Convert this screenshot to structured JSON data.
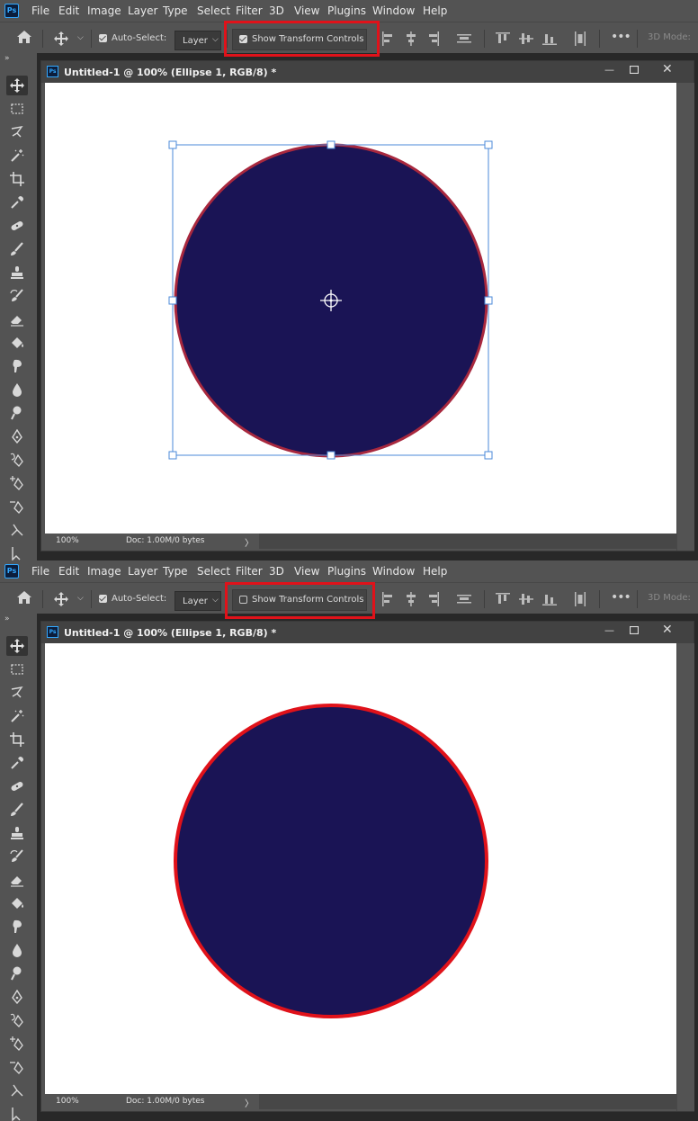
{
  "menus": [
    "File",
    "Edit",
    "Image",
    "Layer",
    "Type",
    "Select",
    "Filter",
    "3D",
    "View",
    "Plugins",
    "Window",
    "Help"
  ],
  "options": {
    "auto_select_label": "Auto-Select:",
    "layer_dropdown": "Layer",
    "show_transform_controls_label": "Show Transform Controls",
    "mode_3d_label": "3D Mode:"
  },
  "document": {
    "title": "Untitled-1 @ 100% (Ellipse 1, RGB/8) *",
    "zoom": "100%",
    "doc_info": "Doc: 1.00M/0 bytes"
  },
  "tools": [
    "move-tool",
    "marquee-tool",
    "lasso-tool",
    "magic-wand-tool",
    "crop-tool",
    "eyedropper-tool",
    "healing-brush-tool",
    "brush-tool",
    "clone-stamp-tool",
    "history-brush-tool",
    "eraser-tool",
    "paint-bucket-tool",
    "smudge-tool",
    "blur-tool",
    "dodge-tool",
    "pen-tool",
    "freeform-pen-tool",
    "add-anchor-tool",
    "delete-anchor-tool",
    "convert-point-tool",
    "path-selection-tool"
  ],
  "panels": [
    {
      "transform_controls_checked": true,
      "selection_visible": true,
      "ellipse_stroke_color": "#a8283e"
    },
    {
      "transform_controls_checked": false,
      "selection_visible": false,
      "ellipse_stroke_color": "#e0121a"
    }
  ],
  "colors": {
    "ellipse_fill": "#1a1455",
    "highlight": "#e0121a",
    "selection": "#4b8ad8",
    "ps_brand": "#31a8ff"
  }
}
